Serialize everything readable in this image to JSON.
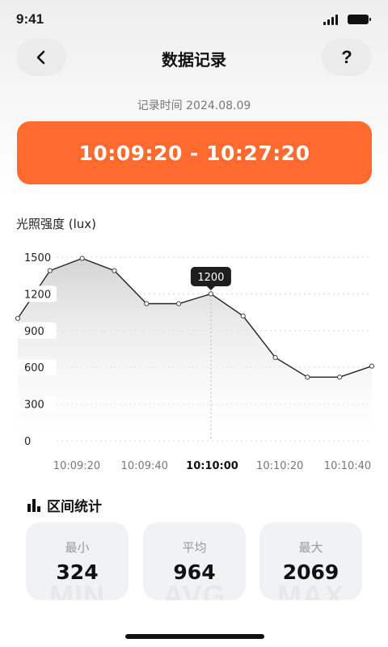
{
  "status": {
    "time": "9:41"
  },
  "nav": {
    "back_icon": "‹",
    "title": "数据记录",
    "help_label": "?"
  },
  "record": {
    "date_label": "记录时间 2024.08.09",
    "time_range": "10:09:20 - 10:27:20"
  },
  "chart_data": {
    "type": "area",
    "title": "光照强度 (lux)",
    "ylim": [
      0,
      1500
    ],
    "yticks": [
      "1500",
      "1200",
      "900",
      "600",
      "300",
      "0"
    ],
    "x_labels": [
      "10:09:20",
      "10:09:40",
      "10:10:00",
      "10:10:20",
      "10:10:40"
    ],
    "selected_x_label": "10:10:00",
    "values": [
      1000,
      1390,
      1490,
      1390,
      1120,
      1120,
      1200,
      1020,
      680,
      520,
      520,
      610
    ],
    "tooltip": {
      "index": 6,
      "label": "1200"
    },
    "grid": true
  },
  "stats": {
    "title": "区间统计",
    "cards": [
      {
        "label": "最小",
        "value": "324",
        "watermark": "MIN"
      },
      {
        "label": "平均",
        "value": "964",
        "watermark": "AVG"
      },
      {
        "label": "最大",
        "value": "2069",
        "watermark": "MAX"
      }
    ]
  },
  "colors": {
    "accent": "#ff6b2f"
  }
}
